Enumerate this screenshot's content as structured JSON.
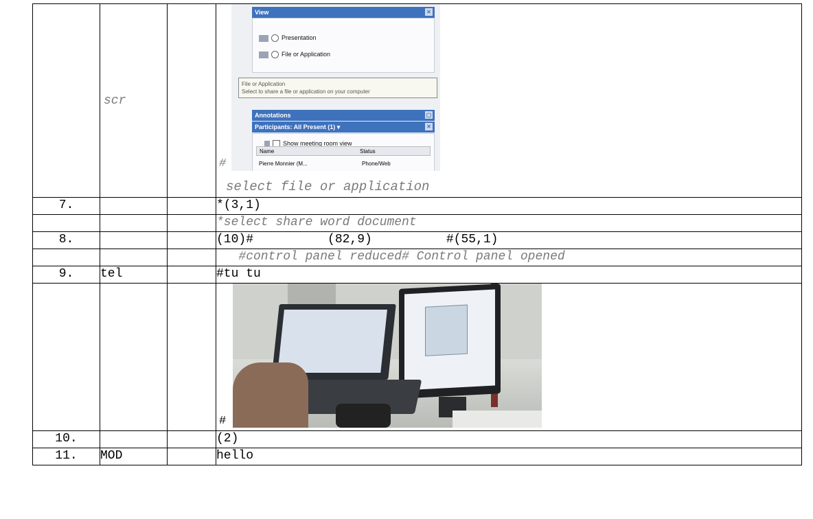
{
  "rows": [
    {
      "num": "",
      "speaker": "scr",
      "text": "select file or application",
      "marker": "#"
    },
    {
      "num": "7.",
      "speaker": "",
      "text": "*(3,1)"
    },
    {
      "num": "",
      "speaker": "",
      "text": "*select share word document"
    },
    {
      "num": "8.",
      "speaker": "",
      "text": "(10)#          (82,9)          #(55,1)"
    },
    {
      "num": "",
      "speaker": "",
      "text": "   #control panel reduced# Control panel opened"
    },
    {
      "num": "9.",
      "speaker": "tel",
      "text": "#tu tu"
    },
    {
      "num": "",
      "speaker": "",
      "text": "",
      "marker": "#"
    },
    {
      "num": "10.",
      "speaker": "",
      "text": "(2)"
    },
    {
      "num": "11.",
      "speaker": "MOD",
      "text": "hello"
    }
  ],
  "screenshot": {
    "view_title": "View",
    "option_presentation": "Presentation",
    "option_file": "File or Application",
    "tooltip_title": "File or Application",
    "tooltip_text": "Select to share a file or application on your computer",
    "annotations_title": "Annotations",
    "participants_title": "Participants: All Present (1) ▾",
    "checkbox_label": "Show meeting room view",
    "col_name": "Name",
    "col_status": "Status",
    "row_name": "Pierre Monnier (M...",
    "row_status": "Phone/Web"
  }
}
